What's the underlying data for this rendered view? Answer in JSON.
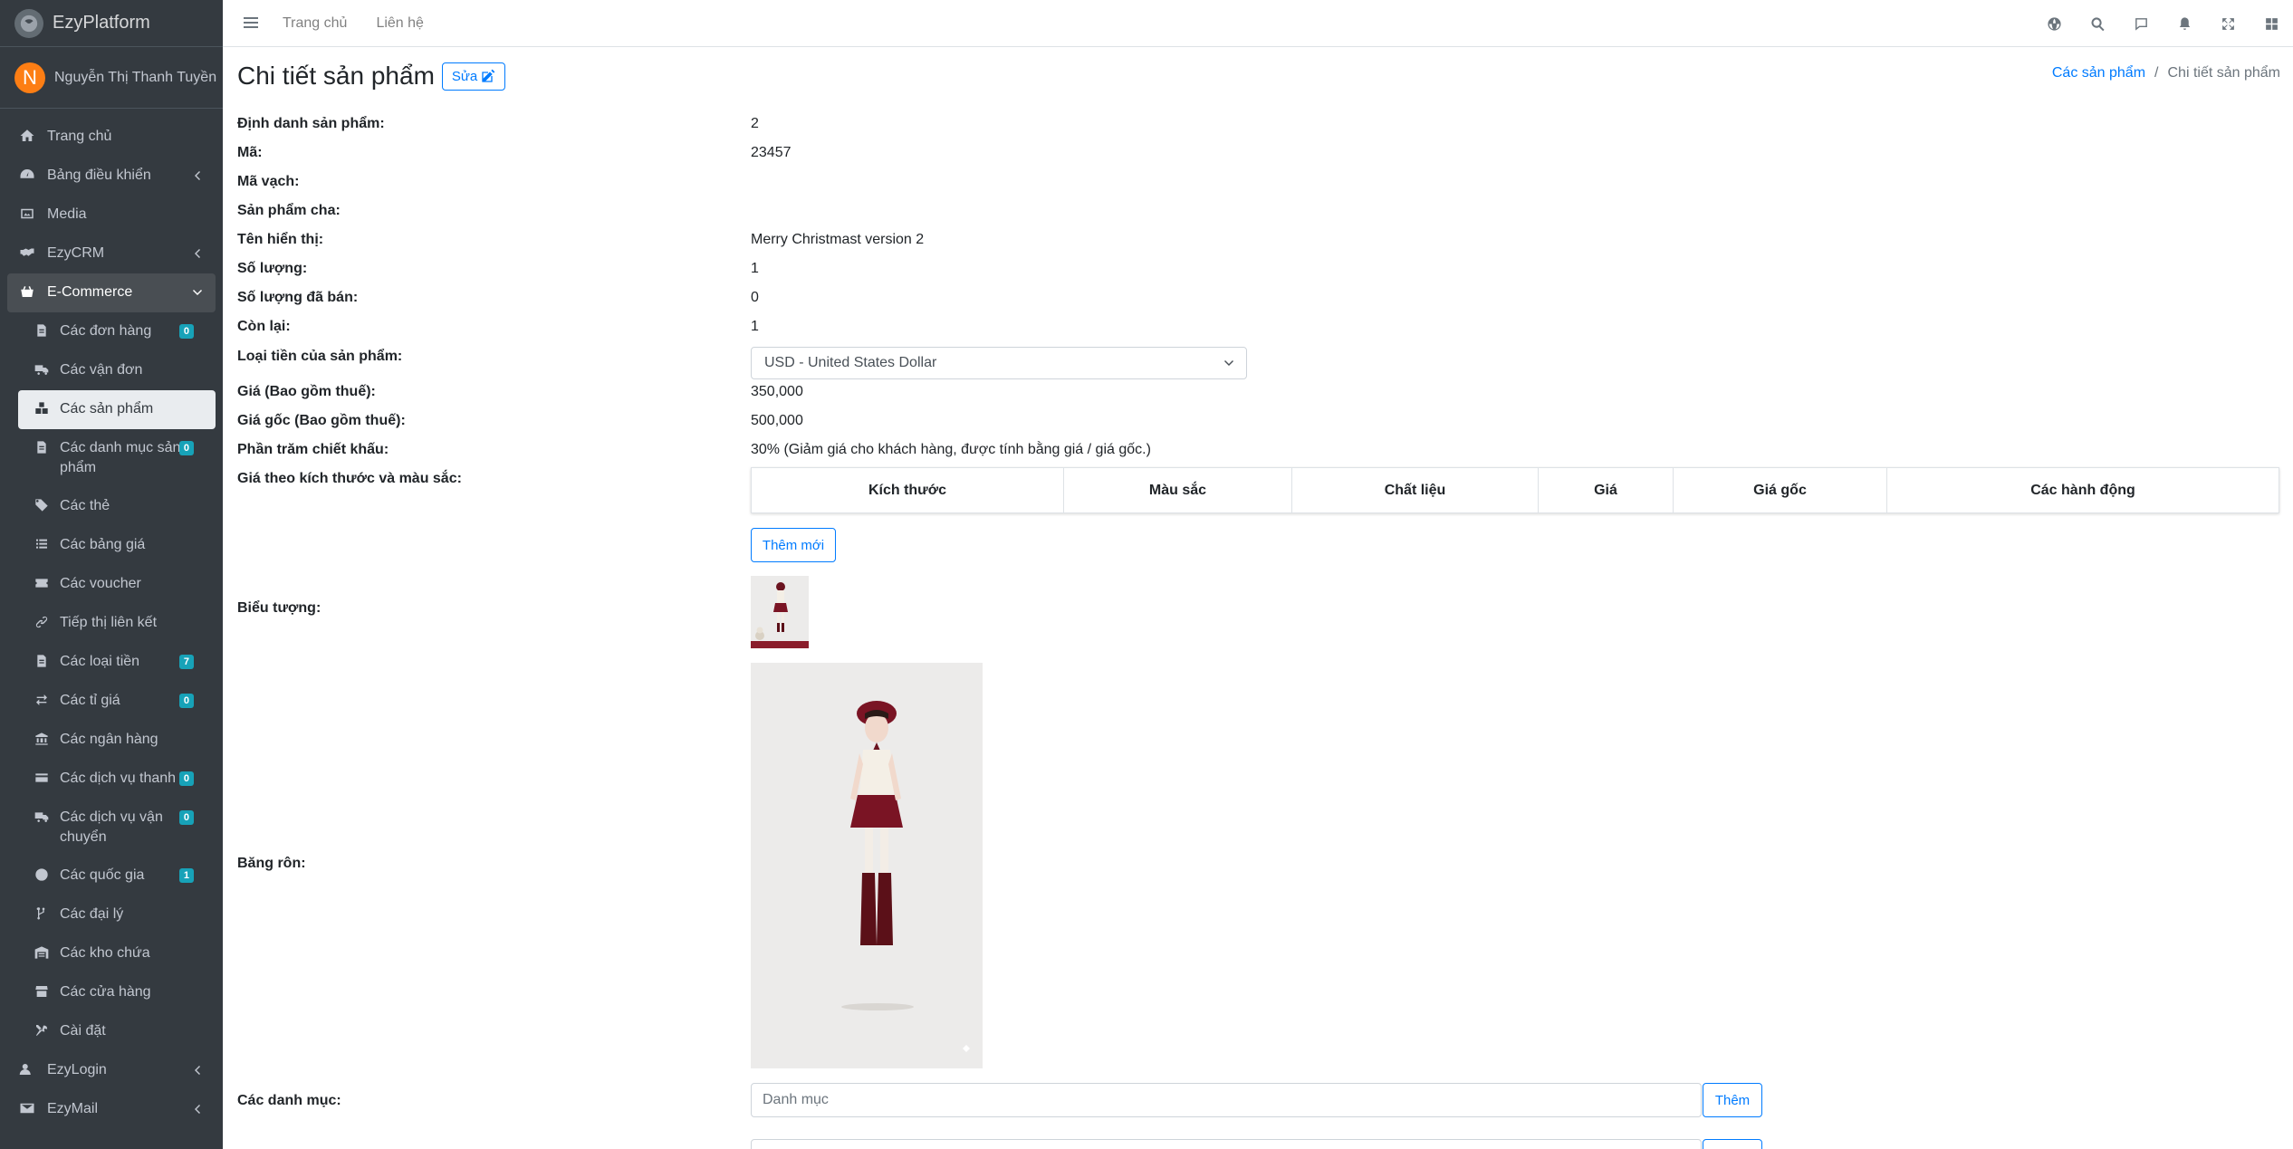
{
  "brand": {
    "name": "EzyPlatform"
  },
  "user": {
    "initial": "N",
    "name": "Nguyễn Thị Thanh Tuyền"
  },
  "topbar": {
    "links": [
      "Trang chủ",
      "Liên hệ"
    ]
  },
  "sidebar": {
    "items": [
      {
        "label": "Trang chủ"
      },
      {
        "label": "Bảng điều khiển"
      },
      {
        "label": "Media"
      },
      {
        "label": "EzyCRM"
      },
      {
        "label": "E-Commerce"
      },
      {
        "label": "Các đơn hàng",
        "badge": "0"
      },
      {
        "label": "Các vận đơn"
      },
      {
        "label": "Các sản phẩm"
      },
      {
        "label": "Các danh mục sản phẩm",
        "badge": "0"
      },
      {
        "label": "Các thẻ"
      },
      {
        "label": "Các bảng giá"
      },
      {
        "label": "Các voucher"
      },
      {
        "label": "Tiếp thị liên kết"
      },
      {
        "label": "Các loại tiền",
        "badge": "7"
      },
      {
        "label": "Các tỉ giá",
        "badge": "0"
      },
      {
        "label": "Các ngân hàng"
      },
      {
        "label": "Các dịch vụ thanh toán",
        "badge": "0"
      },
      {
        "label": "Các dịch vụ vận chuyển",
        "badge": "0"
      },
      {
        "label": "Các quốc gia",
        "badge": "1"
      },
      {
        "label": "Các đại lý"
      },
      {
        "label": "Các kho chứa"
      },
      {
        "label": "Các cửa hàng"
      },
      {
        "label": "Cài đặt"
      },
      {
        "label": "EzyLogin"
      },
      {
        "label": "EzyMail"
      }
    ]
  },
  "page": {
    "title": "Chi tiết sản phẩm",
    "edit_label": "Sửa",
    "breadcrumb": {
      "parent": "Các sản phẩm",
      "current": "Chi tiết sản phẩm"
    }
  },
  "details": {
    "labels": {
      "id": "Định danh sản phẩm:",
      "code": "Mã:",
      "barcode": "Mã vạch:",
      "parent": "Sản phẩm cha:",
      "display_name": "Tên hiển thị:",
      "quantity": "Số lượng:",
      "sold": "Số lượng đã bán:",
      "remaining": "Còn lại:",
      "currency": "Loại tiền của sản phẩm:",
      "price": "Giá (Bao gồm thuế):",
      "original_price": "Giá gốc (Bao gồm thuế):",
      "discount": "Phần trăm chiết khấu:",
      "price_by_size_color": "Giá theo kích thước và màu sắc:",
      "icon": "Biểu tượng:",
      "banner": "Băng rôn:",
      "categories": "Các danh mục:"
    },
    "values": {
      "id": "2",
      "code": "23457",
      "barcode": "",
      "parent": "",
      "display_name": "Merry Christmast version 2",
      "quantity": "1",
      "sold": "0",
      "remaining": "1",
      "currency": "USD - United States Dollar",
      "price": "350,000",
      "original_price": "500,000",
      "discount": "30% (Giảm giá cho khách hàng, được tính bằng giá / giá gốc.)"
    }
  },
  "price_table": {
    "headers": [
      "Kích thước",
      "Màu sắc",
      "Chất liệu",
      "Giá",
      "Giá gốc",
      "Các hành động"
    ]
  },
  "add_new_label": "Thêm mới",
  "category_input": {
    "placeholder": "Danh mục",
    "button": "Thêm"
  }
}
